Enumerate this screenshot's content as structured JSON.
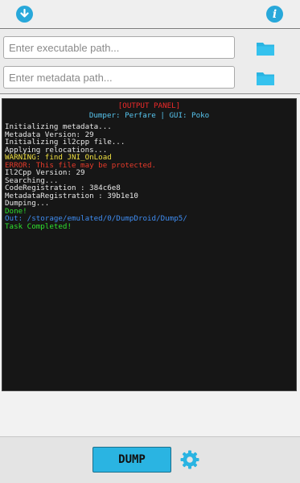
{
  "topbar": {
    "left_icon": "download-icon",
    "right_icon": "info-icon",
    "accent": "#28a8da"
  },
  "inputs": {
    "executable": {
      "value": "",
      "placeholder": "Enter executable path..."
    },
    "metadata": {
      "value": "",
      "placeholder": "Enter metadata path..."
    },
    "folder_icon": "folder-icon",
    "folder_color": "#2ab4e2"
  },
  "output": {
    "title": "[OUTPUT PANEL]",
    "subtitle": "Dumper: Perfare | GUI: Poko",
    "lines": [
      {
        "text": "Initializing metadata...",
        "kind": "normal"
      },
      {
        "text": "Metadata Version: 29",
        "kind": "normal"
      },
      {
        "text": "Initializing il2cpp file...",
        "kind": "normal"
      },
      {
        "text": "Applying relocations...",
        "kind": "normal"
      },
      {
        "text": "WARNING: find JNI_OnLoad",
        "kind": "warning"
      },
      {
        "text": "ERROR: This file may be protected.",
        "kind": "error"
      },
      {
        "text": "Il2Cpp Version: 29",
        "kind": "normal"
      },
      {
        "text": "Searching...",
        "kind": "normal"
      },
      {
        "text": "CodeRegistration : 384c6e8",
        "kind": "normal"
      },
      {
        "text": "MetadataRegistration : 39b1e10",
        "kind": "normal"
      },
      {
        "text": "Dumping...",
        "kind": "normal"
      },
      {
        "text": "Done!",
        "kind": "success"
      },
      {
        "text": "Out: /storage/emulated/0/DumpDroid/Dump5/",
        "kind": "info"
      },
      {
        "text": "Task Completed!",
        "kind": "success"
      }
    ]
  },
  "bottombar": {
    "dump_label": "DUMP",
    "settings_icon": "gear-icon"
  }
}
